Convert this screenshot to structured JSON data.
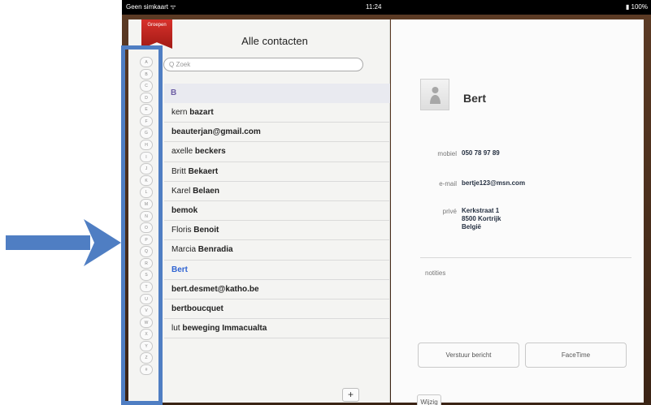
{
  "status_bar": {
    "carrier": "Geen simkaart",
    "time": "11:24",
    "battery": "100%"
  },
  "left_page": {
    "groups_label": "Groepen",
    "title": "Alle contacten",
    "search_placeholder": "Q Zoek",
    "index_letters": [
      "A",
      "B",
      "C",
      "D",
      "E",
      "F",
      "G",
      "H",
      "I",
      "J",
      "K",
      "L",
      "M",
      "N",
      "O",
      "P",
      "Q",
      "R",
      "S",
      "T",
      "U",
      "V",
      "W",
      "X",
      "Y",
      "Z",
      "#"
    ],
    "section_letter": "B",
    "contacts": [
      {
        "first": "kern",
        "last": "bazart"
      },
      {
        "first": "",
        "last": "beauterjan@gmail.com"
      },
      {
        "first": "axelle",
        "last": "beckers"
      },
      {
        "first": "Britt",
        "last": "Bekaert"
      },
      {
        "first": "Karel",
        "last": "Belaen"
      },
      {
        "first": "",
        "last": "bemok"
      },
      {
        "first": "Floris",
        "last": "Benoit"
      },
      {
        "first": "Marcia",
        "last": "Benradia"
      },
      {
        "first": "",
        "last": "Bert",
        "selected": true
      },
      {
        "first": "",
        "last": "bert.desmet@katho.be"
      },
      {
        "first": "",
        "last": "bertboucquet"
      },
      {
        "first": "lut",
        "last": "beweging Immacualta"
      }
    ],
    "add_label": "+"
  },
  "right_page": {
    "name": "Bert",
    "fields": {
      "mobile_label": "mobiel",
      "mobile_value": "050 78 97 89",
      "email_label": "e-mail",
      "email_value": "bertje123@msn.com",
      "private_label": "privé",
      "address_lines": [
        "Kerkstraat 1",
        "8500 Kortrijk",
        "België"
      ]
    },
    "notes_label": "notities",
    "send_message_label": "Verstuur bericht",
    "facetime_label": "FaceTime",
    "edit_label": "Wijzig"
  },
  "icons": {
    "wifi": "wifi-icon",
    "avatar": "contact-avatar-icon",
    "arrow": "annotation-arrow-icon"
  },
  "colors": {
    "annotation": "#4f7ec3",
    "selected_contact": "#3064d2",
    "section_letter": "#6d5ea4",
    "groups_ribbon": "#c8261f"
  }
}
